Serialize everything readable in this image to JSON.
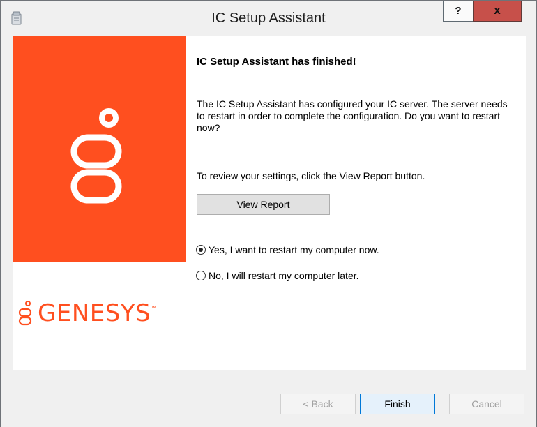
{
  "window": {
    "title": "IC Setup Assistant",
    "help_label": "?",
    "close_label": "x"
  },
  "brand": {
    "name": "GENESYS",
    "trademark": "™",
    "color": "#ff4f1f"
  },
  "content": {
    "heading": "IC Setup Assistant has finished!",
    "message": "The IC Setup Assistant has configured your IC server. The server needs to restart in order to complete the configuration. Do you want to restart now?",
    "review_text": "To review your settings, click the View Report button.",
    "view_report_label": "View Report",
    "options": [
      {
        "label": "Yes, I want to restart my computer now.",
        "selected": true
      },
      {
        "label": "No, I will restart my computer later.",
        "selected": false
      }
    ]
  },
  "footer": {
    "back_label": "< Back",
    "finish_label": "Finish",
    "cancel_label": "Cancel"
  }
}
